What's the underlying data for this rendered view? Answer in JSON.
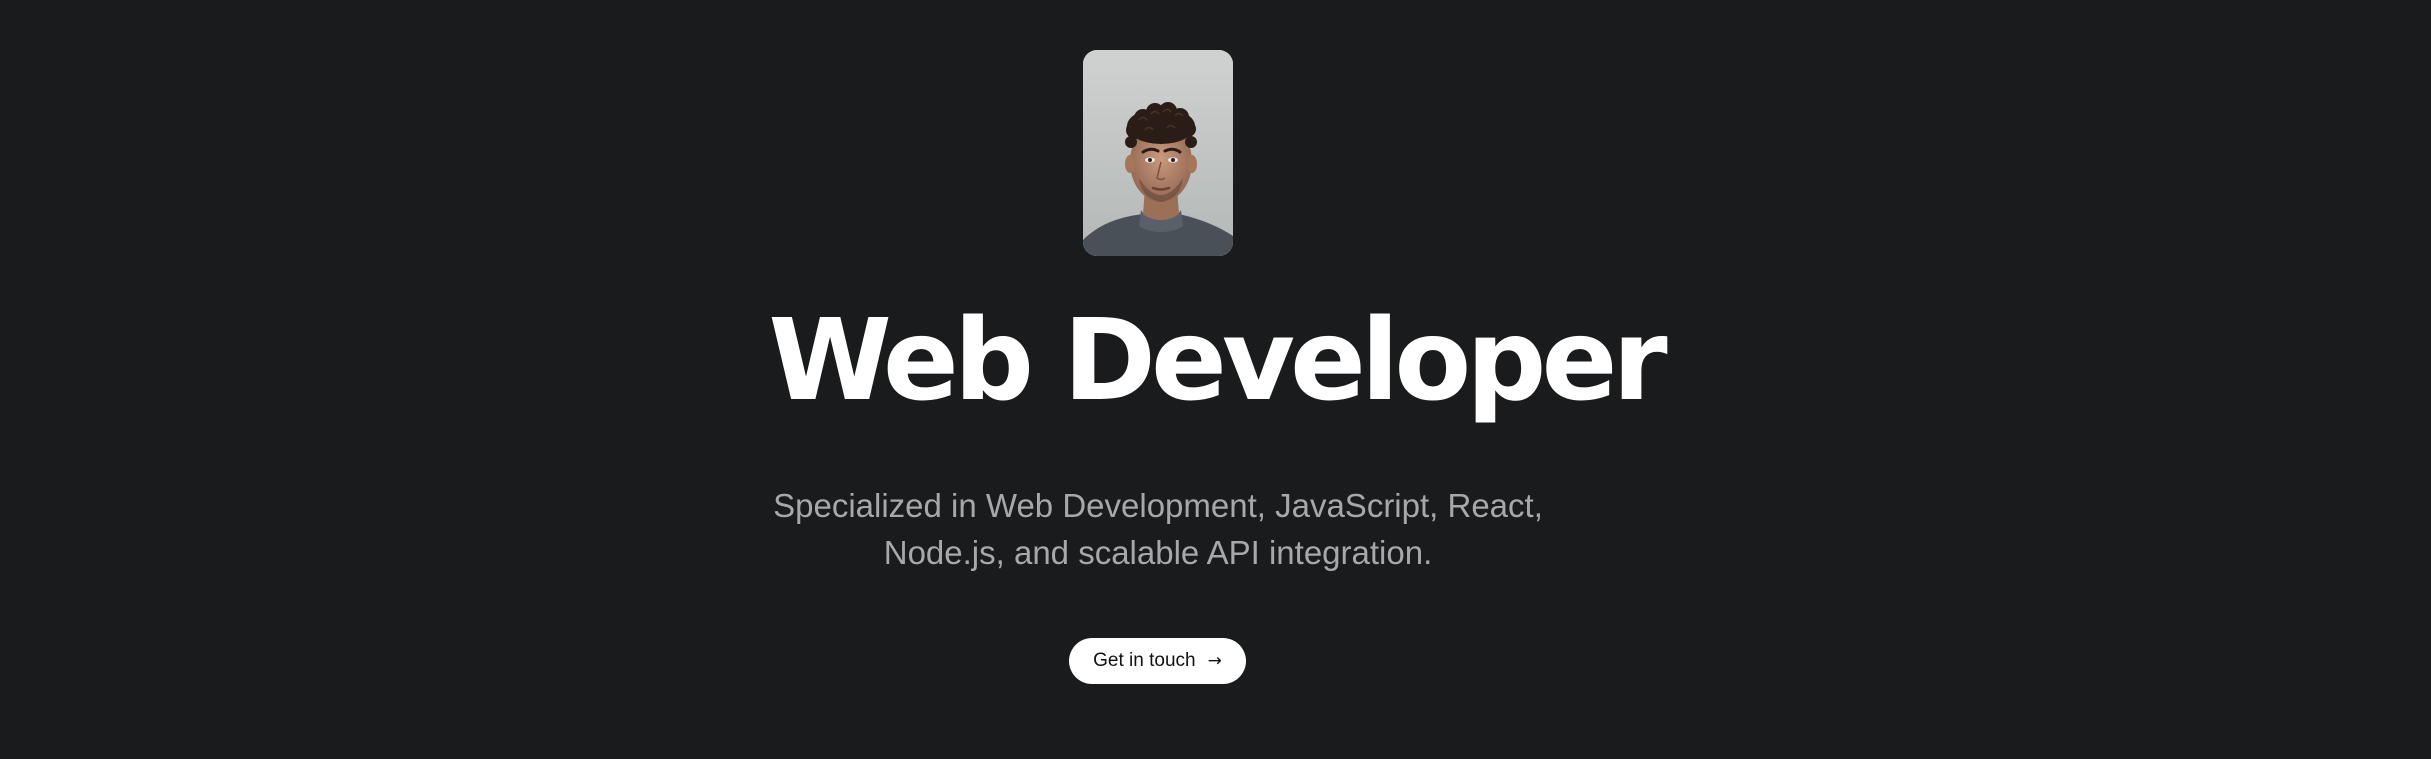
{
  "hero": {
    "title": "Web Developer",
    "subtitle": "Specialized in Web Development, JavaScript, React, Node.js, and scalable API integration.",
    "cta": {
      "label": "Get in touch",
      "icon": "arrow-right-icon",
      "icon_glyph": "→"
    },
    "avatar_alt": "Portrait of developer"
  },
  "colors": {
    "background": "#1a1b1d",
    "title": "#ffffff",
    "subtitle": "#a7a8aa",
    "button_bg": "#ffffff",
    "button_text": "#111111"
  }
}
